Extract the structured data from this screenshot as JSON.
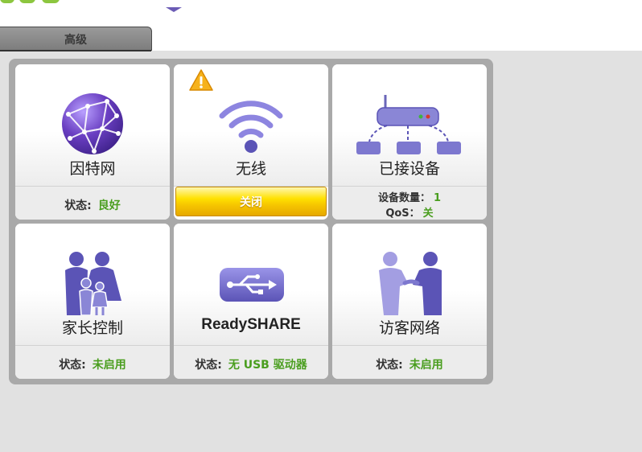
{
  "header": {
    "tab_label": "高级"
  },
  "tiles": [
    {
      "title": "因特网",
      "status_label": "状态:",
      "status_value": "良好"
    },
    {
      "title": "无线",
      "button_label": "关闭"
    },
    {
      "title": "已接设备",
      "device_count_label": "设备数量：",
      "device_count_value": "1",
      "qos_label": "QoS：",
      "qos_value": "关"
    },
    {
      "title": "家长控制",
      "status_label": "状态:",
      "status_value": "未启用"
    },
    {
      "title": "ReadySHARE",
      "status_label": "状态:",
      "status_value": "无 USB 驱动器"
    },
    {
      "title": "访客网络",
      "status_label": "状态:",
      "status_value": "未启用"
    }
  ],
  "colors": {
    "status_green": "#4a9e1f",
    "icon_purple": "#5b54b6",
    "warning_yellow": "#f7c800"
  },
  "icons": [
    "globe-icon",
    "wifi-icon",
    "warning-icon",
    "router-icon",
    "family-icon",
    "usb-icon",
    "guest-icon"
  ]
}
